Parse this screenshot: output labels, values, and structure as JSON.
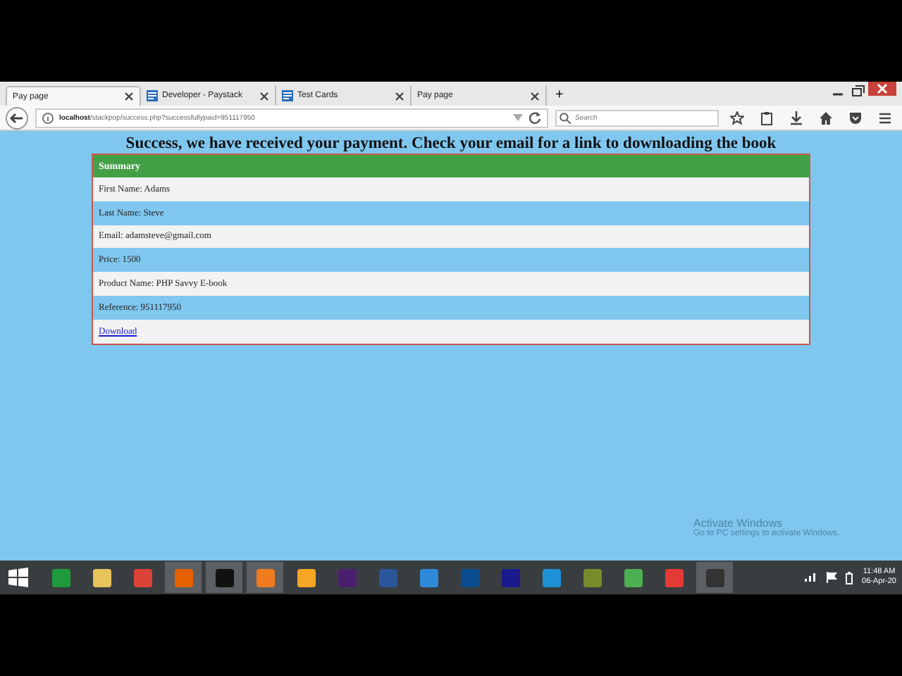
{
  "browser": {
    "tabs": [
      {
        "label": "Pay page",
        "selected": true,
        "icon": false
      },
      {
        "label": "Developer - Paystack",
        "selected": false,
        "icon": true
      },
      {
        "label": "Test Cards",
        "selected": false,
        "icon": true
      },
      {
        "label": "Pay page",
        "selected": false,
        "icon": false
      }
    ],
    "new_tab": "+",
    "address": {
      "host": "localhost",
      "path": "/stackpop/success.php?successfullypaid=951117950"
    },
    "search": {
      "placeholder": "Search"
    }
  },
  "page": {
    "heading": "Success, we have received your payment. Check your email for a link to downloading the book",
    "summary": {
      "title": "Summary",
      "rows": [
        {
          "kind": "text",
          "text": "First Name: Adams"
        },
        {
          "kind": "text",
          "text": "Last Name: Steve"
        },
        {
          "kind": "text",
          "text": "Email: adamsteve@gmail.com"
        },
        {
          "kind": "text",
          "text": "Price: 1500"
        },
        {
          "kind": "text",
          "text": "Product Name: PHP Savvy E-book"
        },
        {
          "kind": "text",
          "text": "Reference: 951117950"
        },
        {
          "kind": "link",
          "text": "Download"
        }
      ]
    }
  },
  "watermark": {
    "title": "Activate Windows",
    "subtitle": "Go to PC settings to activate Windows."
  },
  "taskbar": {
    "apps": [
      {
        "color": "#1e9a3c",
        "active": false
      },
      {
        "color": "#e8c35a",
        "active": false
      },
      {
        "color": "#db4437",
        "active": false
      },
      {
        "color": "#e66000",
        "active": true
      },
      {
        "color": "#111111",
        "active": true
      },
      {
        "color": "#f07a1e",
        "active": true
      },
      {
        "color": "#f5a623",
        "active": false
      },
      {
        "color": "#4b1f6f",
        "active": false
      },
      {
        "color": "#2b579a",
        "active": false
      },
      {
        "color": "#2d8ad8",
        "active": false
      },
      {
        "color": "#0b4d8f",
        "active": false
      },
      {
        "color": "#1a1a8c",
        "active": false
      },
      {
        "color": "#1e90d6",
        "active": false
      },
      {
        "color": "#7a8b2c",
        "active": false
      },
      {
        "color": "#4caf50",
        "active": false
      },
      {
        "color": "#e53935",
        "active": false
      },
      {
        "color": "#333333",
        "active": true
      }
    ],
    "time": "11:48 AM",
    "date": "06-Apr-20"
  }
}
